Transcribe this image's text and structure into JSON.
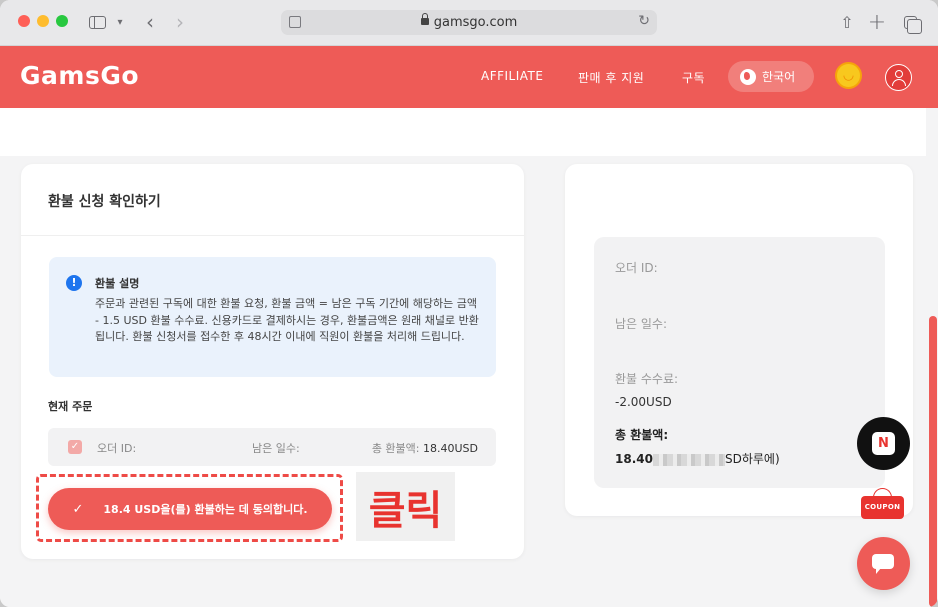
{
  "browser": {
    "url": "gamsgo.com",
    "icons": [
      "sidebar-icon",
      "chevron-down-icon",
      "back-icon",
      "forward-icon",
      "lock-icon",
      "reload-icon",
      "share-icon",
      "plus-icon",
      "tabs-icon"
    ]
  },
  "header": {
    "logo": "GamsGo",
    "nav": {
      "affiliate": "AFFILIATE",
      "support": "판매 후 지원",
      "subscribe": "구독"
    },
    "language": "한국어",
    "brand_color": "#ee5b57"
  },
  "refund_card": {
    "title": "환불 신청 확인하기",
    "notice_title": "환불 설명",
    "notice_body": "주문과 관련된 구독에 대한 환불 요청, 환불 금액 = 남은 구독 기간에 해당하는 금액 - 1.5 USD 환불 수수료. 신용카드로 결제하시는 경우, 환불금액은 원래 채널로 반환됩니다. 환불 신청서를 접수한 후 48시간 이내에 직원이 환불을 처리해 드립니다.",
    "current_order_label": "현재 주문",
    "order": {
      "id_label": "오더 ID:",
      "days_label": "남은 일수:",
      "total_label": "총 환불액:",
      "total_value": "18.40USD"
    },
    "agree_button": "18.4 USD을(를) 환불하는 데 동의합니다."
  },
  "annotation": {
    "click_text": "클릭"
  },
  "summary_card": {
    "order_id_label": "오더 ID:",
    "days_label": "남은 일수:",
    "fee_label": "환불 수수료:",
    "fee_value": "-2.00USD",
    "total_label": "총 환불액:",
    "total_prefix": "18.40",
    "total_suffix": "SD하루에)"
  },
  "floating": {
    "naver_letter": "N",
    "coupon": "COUPON"
  }
}
